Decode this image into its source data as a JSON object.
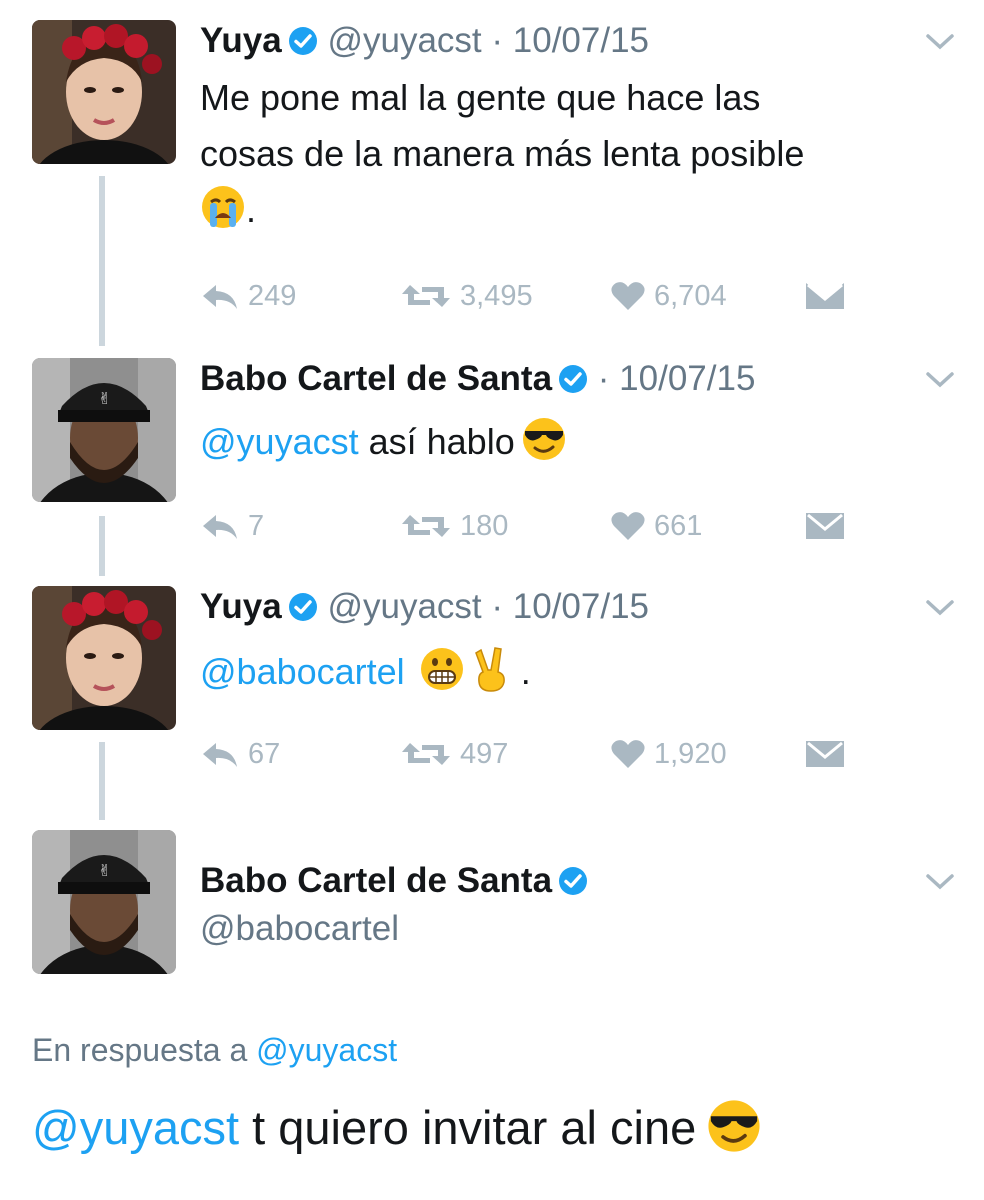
{
  "tweets": [
    {
      "name": "Yuya",
      "handle": "@yuyacst",
      "dot": "·",
      "date": "10/07/15",
      "text_line1": "Me pone mal la gente que hace las",
      "text_line2": "cosas de la manera más lenta posible",
      "text_line3": ".",
      "emoji": "loudly-crying-face",
      "replies": "249",
      "retweets": "3,495",
      "likes": "6,704"
    },
    {
      "name": "Babo Cartel de Santa",
      "dot": "·",
      "date": "10/07/15",
      "mention": "@yuyacst",
      "text": "así hablo",
      "emoji": "sunglasses-face",
      "replies": "7",
      "retweets": "180",
      "likes": "661"
    },
    {
      "name": "Yuya",
      "handle": "@yuyacst",
      "dot": "·",
      "date": "10/07/15",
      "mention": "@babocartel",
      "text_end": ".",
      "emoji": [
        "grimacing-face",
        "victory-hand"
      ],
      "replies": "67",
      "retweets": "497",
      "likes": "1,920"
    },
    {
      "name": "Babo Cartel de Santa",
      "handle": "@babocartel"
    }
  ],
  "reply_context": {
    "prefix": "En respuesta a",
    "mention": "@yuyacst"
  },
  "main_tweet": {
    "mention": "@yuyacst",
    "text": "t quiero invitar al cine",
    "emoji": "sunglasses-face"
  },
  "colors": {
    "accent": "#1da1f2",
    "secondary_text": "#657786",
    "icon_gray": "#aab8c2",
    "thread_line": "#ccd6dd"
  }
}
